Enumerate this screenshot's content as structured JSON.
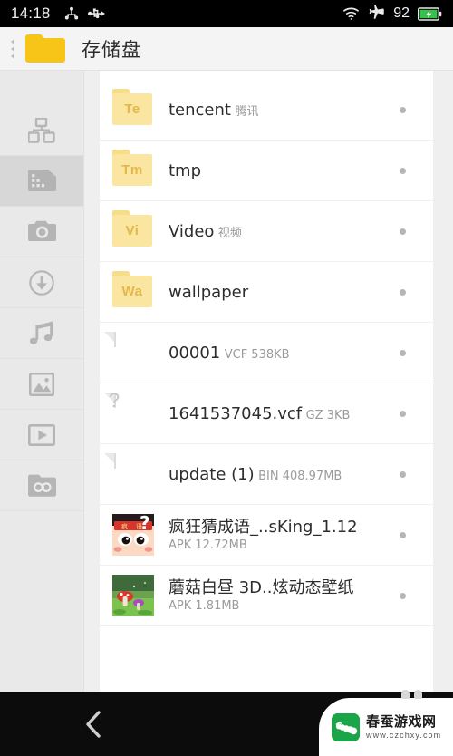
{
  "status_bar": {
    "time": "14:18",
    "left_icons": [
      "share-nodes-icon",
      "usb-icon"
    ],
    "wifi_icon": "wifi-icon",
    "airplane_icon": "airplane-mode-icon",
    "battery_level": "92",
    "battery_icon": "battery-charging-icon"
  },
  "title_bar": {
    "back_arrows_icon": "triple-left-arrow-icon",
    "folder_icon": "folder-icon",
    "title": "存储盘"
  },
  "sidebar": {
    "items": [
      {
        "name": "apps",
        "icon": "apps-grid-icon",
        "selected": false
      },
      {
        "name": "sdcard",
        "icon": "sd-card-icon",
        "selected": true
      },
      {
        "name": "camera",
        "icon": "camera-icon",
        "selected": false
      },
      {
        "name": "downloads",
        "icon": "download-circle-icon",
        "selected": false
      },
      {
        "name": "music",
        "icon": "music-note-icon",
        "selected": false
      },
      {
        "name": "images",
        "icon": "image-icon",
        "selected": false
      },
      {
        "name": "videos",
        "icon": "video-play-icon",
        "selected": false
      },
      {
        "name": "private",
        "icon": "private-folder-icon",
        "selected": false
      }
    ]
  },
  "file_list": {
    "rows": [
      {
        "kind": "folder",
        "initials": "Te",
        "title": "tencent",
        "subtitle": "腾讯"
      },
      {
        "kind": "folder",
        "initials": "Tm",
        "title": "tmp",
        "subtitle": ""
      },
      {
        "kind": "folder",
        "initials": "Vi",
        "title": "Video",
        "subtitle": "视频"
      },
      {
        "kind": "folder",
        "initials": "Wa",
        "title": "wallpaper",
        "subtitle": ""
      },
      {
        "kind": "doc",
        "glyph": "contact-icon",
        "title": "00001",
        "subtitle": "VCF 538KB"
      },
      {
        "kind": "doc",
        "glyph": "question-icon",
        "title": "1641537045.vcf",
        "subtitle": "GZ 3KB"
      },
      {
        "kind": "doc",
        "glyph": "cloud-icon",
        "title": "update (1)",
        "subtitle": "BIN 408.97MB"
      },
      {
        "kind": "app",
        "art": "idiom-game-icon",
        "title": "疯狂猜成语_..sKing_1.12",
        "subtitle": "APK 12.72MB"
      },
      {
        "kind": "app",
        "art": "mushroom-wallpaper-icon",
        "title": "蘑菇白昼 3D..炫动态壁纸",
        "subtitle": "APK 1.81MB"
      }
    ],
    "row_marker_icon": "more-dot-icon"
  },
  "nav_bar": {
    "back_icon": "back-chevron-icon"
  },
  "watermark": {
    "site_name": "春蚕游戏网",
    "site_url": "www.czchxy.com",
    "logo_icon": "silkworm-logo-icon"
  },
  "colors": {
    "accent_folder": "#fae6a0",
    "folder_title_icon": "#f6c518",
    "selected_sidebar": "#d7d7d7",
    "battery_green": "#36c24a",
    "watermark_green": "#1aa548"
  }
}
